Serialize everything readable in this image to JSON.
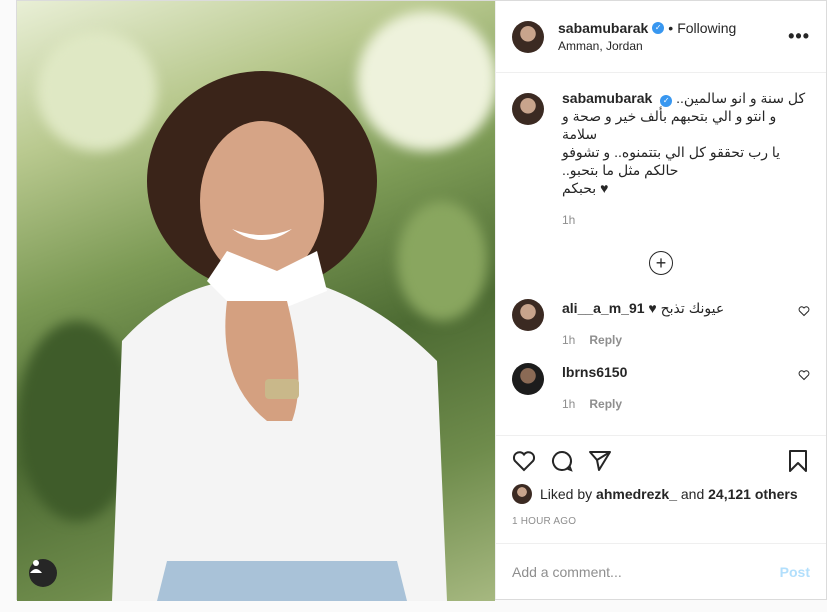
{
  "post": {
    "author": "sabamubarak",
    "follow_status": "Following",
    "location": "Amman, Jordan",
    "more_label": "•••",
    "caption_lines": [
      "كل سنة و انو سالمين..",
      "و انتو و الي بتحبهم بألف خير و صحة و سلامة",
      "يا رب تحققو كل الي بتتمنوه.. و تشوفو حالكم مثل ما بتحبو..",
      "♥ بحبكم"
    ],
    "caption_time": "1h",
    "likes_prefix": "Liked by",
    "likes_user": "ahmedrezk_",
    "likes_and": "and",
    "likes_count": "24,121 others",
    "posted_time": "1 HOUR AGO",
    "comment_placeholder": "Add a comment...",
    "post_label": "Post"
  },
  "comments": [
    {
      "user": "ali__a_m_91",
      "text": "عيونك تذبح ♥",
      "time": "1h",
      "reply": "Reply"
    },
    {
      "user": "lbrns6150",
      "text": "",
      "time": "1h",
      "reply": "Reply"
    }
  ],
  "icons": [
    "verified-badge-icon",
    "heart-icon",
    "comment-icon",
    "share-icon",
    "bookmark-icon",
    "add-circle-icon",
    "user-tag-icon"
  ],
  "colors": {
    "accent": "#3897f0",
    "post_disabled": "#b2dffc",
    "muted": "#8e8e8e"
  }
}
